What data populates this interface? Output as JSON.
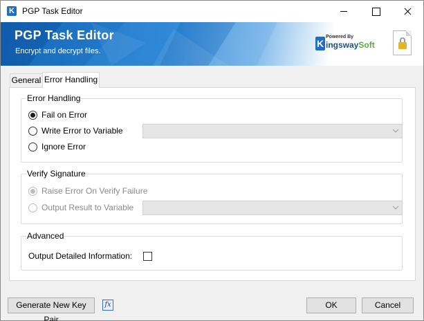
{
  "window": {
    "title": "PGP Task Editor",
    "icon": "kingsway-k-icon",
    "controls": [
      "minimize-icon",
      "maximize-icon",
      "close-icon"
    ]
  },
  "banner": {
    "title": "PGP Task Editor",
    "subtitle": "Encrypt and decrypt files.",
    "brand_powered": "Powered By",
    "brand_k": "K",
    "brand_name_main": "ingsway",
    "brand_name_accent": "Soft",
    "lock_icon": "lock-document-icon"
  },
  "tabs": [
    {
      "label": "General",
      "selected": false
    },
    {
      "label": "Error Handling",
      "selected": true
    }
  ],
  "error_handling": {
    "legend": "Error Handling",
    "options": [
      {
        "label": "Fail on Error",
        "checked": true
      },
      {
        "label": "Write Error to Variable",
        "checked": false
      },
      {
        "label": "Ignore Error",
        "checked": false
      }
    ],
    "variable_combo_value": ""
  },
  "verify_signature": {
    "legend": "Verify Signature",
    "options": [
      {
        "label": "Raise Error On Verify Failure",
        "checked": true,
        "disabled": true
      },
      {
        "label": "Output Result to Variable",
        "checked": false,
        "disabled": true
      }
    ],
    "variable_combo_value": ""
  },
  "advanced": {
    "legend": "Advanced",
    "detailed_info_label": "Output Detailed Information:",
    "detailed_info_checked": false
  },
  "footer": {
    "generate_key_label": "Generate New Key Pair",
    "fx_label": "fx",
    "ok_label": "OK",
    "cancel_label": "Cancel"
  },
  "colors": {
    "banner_blue": "#1463b5",
    "brand_green": "#5aa842",
    "lock_gold": "#e6b422"
  }
}
